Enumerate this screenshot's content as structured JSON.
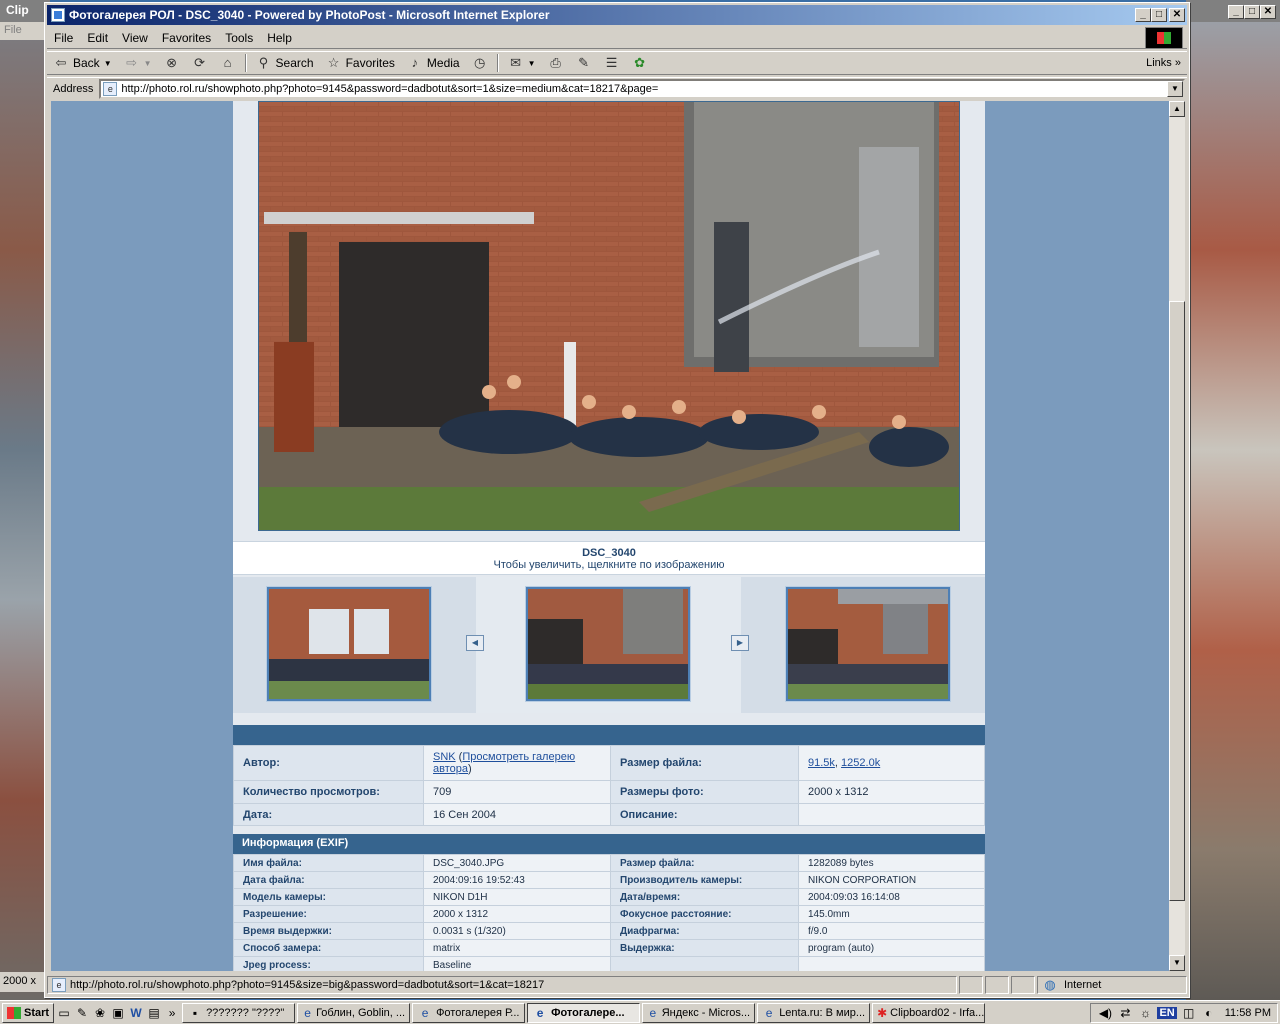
{
  "background_windows": {
    "left_title": "Clip",
    "left_menu_file": "File",
    "left_status": "2000 x"
  },
  "window": {
    "title": "Фотогалерея РОЛ - DSC_3040 - Powered by PhotoPost - Microsoft Internet Explorer",
    "minimize": "_",
    "maximize": "□",
    "close": "✕"
  },
  "menu": [
    "File",
    "Edit",
    "View",
    "Favorites",
    "Tools",
    "Help"
  ],
  "toolbar": {
    "back": "Back",
    "search": "Search",
    "favorites": "Favorites",
    "media": "Media",
    "links": "Links"
  },
  "address": {
    "label": "Address",
    "url": "http://photo.rol.ru/showphoto.php?photo=9145&password=dadbotut&sort=1&size=medium&cat=18217&page="
  },
  "photo": {
    "title": "DSC_3040",
    "hint": "Чтобы увеличить, щелкните по изображению"
  },
  "details": {
    "rows": [
      {
        "l1": "Автор:",
        "v1_link": "SNK",
        "v1_paren_open": " (",
        "v1_link2": "Просмотреть галерею автора",
        "v1_paren_close": ")",
        "l2": "Размер файла:",
        "v2_link": "91.5k",
        "v2_sep": ", ",
        "v2_link2": "1252.0k"
      },
      {
        "l1": "Количество просмотров:",
        "v1": "709",
        "l2": "Размеры фото:",
        "v2": "2000 x 1312"
      },
      {
        "l1": "Дата:",
        "v1": "16 Сен 2004",
        "l2": "Описание:",
        "v2": ""
      }
    ]
  },
  "exif": {
    "header": "Информация (EXIF)",
    "rows": [
      {
        "l1": "Имя файла:",
        "v1": "DSC_3040.JPG",
        "l2": "Размер файла:",
        "v2": "1282089 bytes"
      },
      {
        "l1": "Дата файла:",
        "v1": "2004:09:16 19:52:43",
        "l2": "Производитель камеры:",
        "v2": "NIKON CORPORATION"
      },
      {
        "l1": "Модель камеры:",
        "v1": "NIKON D1H",
        "l2": "Дата/время:",
        "v2": "2004:09:03 16:14:08"
      },
      {
        "l1": "Разрешение:",
        "v1": "2000 x 1312",
        "l2": "Фокусное расстояние:",
        "v2": "145.0mm"
      },
      {
        "l1": "Время выдержки:",
        "v1": "0.0031 s (1/320)",
        "l2": "Диафрагма:",
        "v2": "f/9.0"
      },
      {
        "l1": "Способ замера:",
        "v1": "matrix",
        "l2": "Выдержка:",
        "v2": "program (auto)"
      },
      {
        "l1": "Jpeg process:",
        "v1": "Baseline",
        "l2": "",
        "v2": ""
      }
    ]
  },
  "status": {
    "url": "http://photo.rol.ru/showphoto.php?photo=9145&size=big&password=dadbotut&sort=1&cat=18217",
    "zone": "Internet"
  },
  "taskbar": {
    "start": "Start",
    "tasks": [
      {
        "label": "??????? \"????\"",
        "active": false
      },
      {
        "label": "Гоблин, Goblin, ...",
        "active": false
      },
      {
        "label": "Фотогалерея Р...",
        "active": false
      },
      {
        "label": "Фотогалере...",
        "active": true
      },
      {
        "label": "Яндекс - Micros...",
        "active": false
      },
      {
        "label": "Lenta.ru: В мир...",
        "active": false
      },
      {
        "label": "Clipboard02 - Irfa...",
        "active": false
      }
    ],
    "lang": "EN",
    "clock": "11:58 PM"
  }
}
